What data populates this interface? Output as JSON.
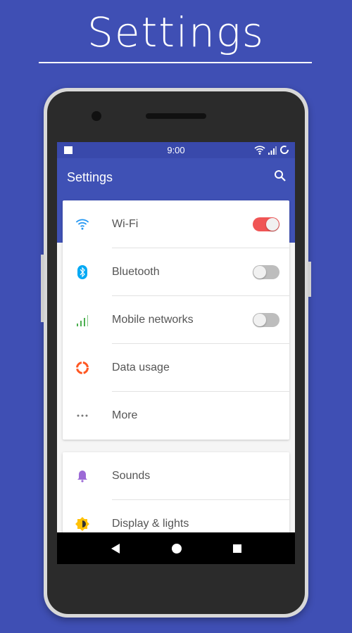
{
  "headline": "Settings",
  "status_bar": {
    "time": "9:00",
    "icons": [
      "image-icon",
      "wifi-icon",
      "signal-icon",
      "battery-ring-icon"
    ]
  },
  "toolbar": {
    "title": "Settings",
    "search_icon": "search-icon"
  },
  "cards": [
    {
      "items": [
        {
          "label": "Wi-Fi",
          "icon": "wifi-icon",
          "color": "#2196f3",
          "toggle": true,
          "on": true
        },
        {
          "label": "Bluetooth",
          "icon": "bluetooth-icon",
          "color": "#03a9f4",
          "toggle": true,
          "on": false
        },
        {
          "label": "Mobile networks",
          "icon": "signal-icon",
          "color": "#4caf50",
          "toggle": true,
          "on": false
        },
        {
          "label": "Data usage",
          "icon": "data-usage-icon",
          "color": "#ff5722",
          "toggle": false
        },
        {
          "label": "More",
          "icon": "more-icon",
          "color": "#777777",
          "toggle": false
        }
      ]
    },
    {
      "items": [
        {
          "label": "Sounds",
          "icon": "bell-icon",
          "color": "#9c6ad6",
          "toggle": false
        },
        {
          "label": "Display & lights",
          "icon": "brightness-icon",
          "color": "#ffc107",
          "toggle": false
        }
      ]
    }
  ],
  "colors": {
    "background": "#3f4fb4",
    "primary": "#3f51b5",
    "primary_dark": "#3949ab",
    "toggle_on": "#f05555"
  }
}
